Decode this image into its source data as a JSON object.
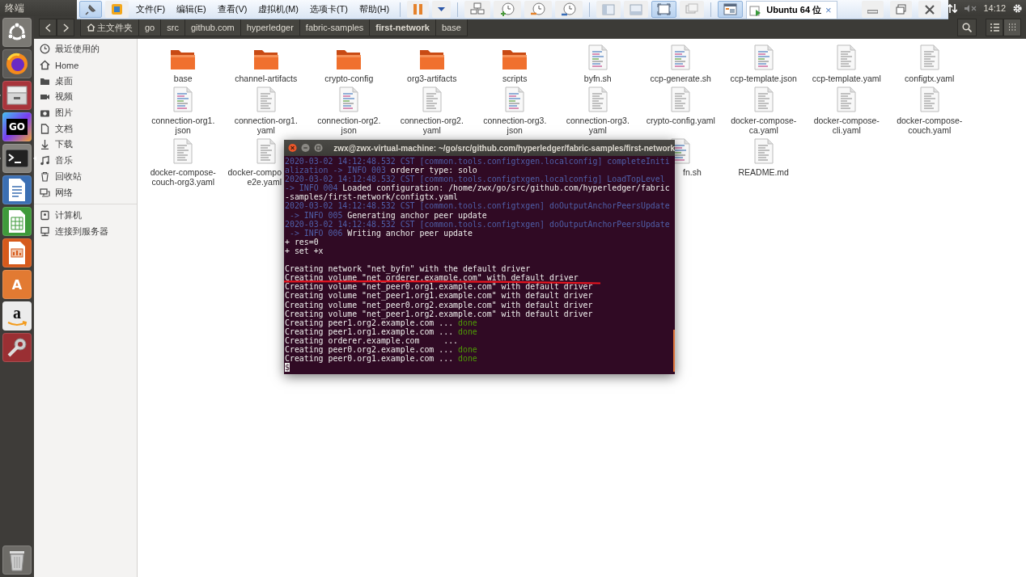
{
  "top_panel": {
    "app_title": "终端",
    "clock": "14:12",
    "tray": [
      {
        "kind": "network"
      },
      {
        "kind": "muted"
      },
      {
        "kind": "clock"
      },
      {
        "kind": "gear"
      }
    ]
  },
  "vm_toolbar": {
    "lead": [
      {
        "kind": "pin",
        "pressed": true
      },
      {
        "kind": "vm-logo",
        "pressed": false
      }
    ],
    "menus": [
      "文件(F)",
      "编辑(E)",
      "查看(V)",
      "虚拟机(M)",
      "选项卡(T)",
      "帮助(H)"
    ],
    "groups": [
      [
        {
          "kind": "pause",
          "pressed": false
        },
        {
          "kind": "caret",
          "pressed": false
        }
      ],
      [
        {
          "kind": "network",
          "pressed": false
        },
        {
          "kind": "snapshot-take",
          "pressed": false
        },
        {
          "kind": "snapshot-revert",
          "pressed": false
        },
        {
          "kind": "snapshot-manager",
          "pressed": false
        }
      ],
      [
        {
          "kind": "view-console",
          "pressed": false
        },
        {
          "kind": "view-thumb",
          "pressed": false
        },
        {
          "kind": "fullscreen",
          "pressed": true
        },
        {
          "kind": "unity",
          "pressed": false
        }
      ],
      [
        {
          "kind": "library",
          "pressed": true
        }
      ]
    ],
    "tab": {
      "label": "Ubuntu 64 位",
      "close": "×"
    },
    "window_buttons": [
      {
        "kind": "minimize"
      },
      {
        "kind": "restore"
      },
      {
        "kind": "close"
      }
    ]
  },
  "launcher": {
    "items": [
      {
        "kind": "dash",
        "running": false,
        "focused": false
      },
      {
        "kind": "firefox",
        "running": false,
        "focused": false
      },
      {
        "kind": "files",
        "running": true,
        "focused": false
      },
      {
        "kind": "goland",
        "glyph": "GO",
        "running": false,
        "focused": false
      },
      {
        "kind": "terminal",
        "running": true,
        "focused": true
      },
      {
        "kind": "writer",
        "running": false,
        "focused": false
      },
      {
        "kind": "calc",
        "running": false,
        "focused": false
      },
      {
        "kind": "impress",
        "running": false,
        "focused": false
      },
      {
        "kind": "software",
        "glyph": "A",
        "running": false,
        "focused": false
      },
      {
        "kind": "amazon",
        "glyph": "a",
        "running": false,
        "focused": false
      },
      {
        "kind": "settings",
        "running": false,
        "focused": false
      }
    ],
    "trash": {
      "kind": "trash"
    }
  },
  "header": {
    "breadcrumbs": [
      {
        "label": "主文件夹",
        "home": true,
        "selected": false
      },
      {
        "label": "go",
        "home": false,
        "selected": false
      },
      {
        "label": "src",
        "home": false,
        "selected": false
      },
      {
        "label": "github.com",
        "home": false,
        "selected": false
      },
      {
        "label": "hyperledger",
        "home": false,
        "selected": false
      },
      {
        "label": "fabric-samples",
        "home": false,
        "selected": false
      },
      {
        "label": "first-network",
        "home": false,
        "selected": true
      },
      {
        "label": "base",
        "home": false,
        "selected": false
      }
    ],
    "view_buttons": [
      {
        "kind": "list",
        "selected": false
      },
      {
        "kind": "grid",
        "selected": true
      }
    ]
  },
  "sidebar": {
    "sections": [
      {
        "items": [
          {
            "kind": "recent",
            "label": "最近使用的"
          },
          {
            "kind": "home",
            "label": "Home"
          },
          {
            "kind": "desktop",
            "label": "桌面"
          },
          {
            "kind": "video",
            "label": "视频"
          },
          {
            "kind": "picture",
            "label": "图片"
          },
          {
            "kind": "document",
            "label": "文档"
          },
          {
            "kind": "download",
            "label": "下载"
          },
          {
            "kind": "music",
            "label": "音乐"
          },
          {
            "kind": "trash",
            "label": "回收站"
          },
          {
            "kind": "network",
            "label": "网络"
          }
        ]
      },
      {
        "items": [
          {
            "kind": "computer",
            "label": "计算机"
          },
          {
            "kind": "server",
            "label": "连接到服务器"
          }
        ]
      }
    ]
  },
  "files": [
    {
      "kind": "folder",
      "lines": [
        "base"
      ]
    },
    {
      "kind": "folder",
      "lines": [
        "channel-artifacts"
      ]
    },
    {
      "kind": "folder",
      "lines": [
        "crypto-config"
      ]
    },
    {
      "kind": "folder",
      "lines": [
        "org3-artifacts"
      ]
    },
    {
      "kind": "folder",
      "lines": [
        "scripts"
      ]
    },
    {
      "kind": "script",
      "lines": [
        "byfn.sh"
      ]
    },
    {
      "kind": "script",
      "lines": [
        "ccp-generate.sh"
      ]
    },
    {
      "kind": "script",
      "lines": [
        "ccp-template.json"
      ]
    },
    {
      "kind": "text",
      "lines": [
        "ccp-template.yaml"
      ]
    },
    {
      "kind": "text",
      "lines": [
        "configtx.yaml"
      ]
    },
    {
      "kind": "script",
      "lines": [
        "connection-org1.",
        "json"
      ]
    },
    {
      "kind": "text",
      "lines": [
        "connection-org1.",
        "yaml"
      ]
    },
    {
      "kind": "script",
      "lines": [
        "connection-org2.",
        "json"
      ]
    },
    {
      "kind": "text",
      "lines": [
        "connection-org2.",
        "yaml"
      ]
    },
    {
      "kind": "script",
      "lines": [
        "connection-org3.",
        "json"
      ]
    },
    {
      "kind": "text",
      "lines": [
        "connection-org3.",
        "yaml"
      ]
    },
    {
      "kind": "text",
      "lines": [
        "crypto-config.yaml"
      ]
    },
    {
      "kind": "text",
      "lines": [
        "docker-compose-",
        "ca.yaml"
      ]
    },
    {
      "kind": "text",
      "lines": [
        "docker-compose-",
        "cli.yaml"
      ]
    },
    {
      "kind": "text",
      "lines": [
        "docker-compose-",
        "couch.yaml"
      ]
    },
    {
      "kind": "text",
      "lines": [
        "docker-compose-",
        "couch-org3.yaml"
      ]
    },
    {
      "kind": "text-cut-right",
      "lines": [
        "docker-compo",
        "e2e.yaml"
      ]
    },
    {
      "kind": "hidden"
    },
    {
      "kind": "hidden"
    },
    {
      "kind": "hidden"
    },
    {
      "kind": "hidden"
    },
    {
      "kind": "script-cut-left",
      "lines": [
        "fn.sh"
      ]
    },
    {
      "kind": "text",
      "lines": [
        "README.md"
      ]
    }
  ],
  "terminal": {
    "title": "zwx@zwx-virtual-machine: ~/go/src/github.com/hyperledger/fabric-samples/first-network",
    "title_buttons": [
      {
        "kind": "close"
      },
      {
        "kind": "minimize"
      },
      {
        "kind": "maximize"
      }
    ],
    "lines": [
      {
        "kind": "text",
        "segments": [
          {
            "kind": "log",
            "text": "2020-03-02 14:12:48.532 CST [common.tools.configtxgen.localconfig] completeIniti"
          }
        ]
      },
      {
        "kind": "text",
        "segments": [
          {
            "kind": "log",
            "text": "alization -> INFO 003"
          },
          {
            "kind": "plain",
            "text": " orderer type: solo"
          }
        ]
      },
      {
        "kind": "text",
        "segments": [
          {
            "kind": "log",
            "text": "2020-03-02 14:12:48.532 CST [common.tools.configtxgen.localconfig] LoadTopLevel"
          }
        ]
      },
      {
        "kind": "text",
        "segments": [
          {
            "kind": "log",
            "text": "-> INFO 004"
          },
          {
            "kind": "plain",
            "text": " Loaded configuration: /home/zwx/go/src/github.com/hyperledger/fabric"
          }
        ]
      },
      {
        "kind": "text",
        "segments": [
          {
            "kind": "plain",
            "text": "-samples/first-network/configtx.yaml"
          }
        ]
      },
      {
        "kind": "text",
        "segments": [
          {
            "kind": "log",
            "text": "2020-03-02 14:12:48.532 CST [common.tools.configtxgen] doOutputAnchorPeersUpdate"
          }
        ]
      },
      {
        "kind": "text",
        "segments": [
          {
            "kind": "log",
            "text": " -> INFO 005"
          },
          {
            "kind": "plain",
            "text": " Generating anchor peer update"
          }
        ]
      },
      {
        "kind": "text",
        "segments": [
          {
            "kind": "log",
            "text": "2020-03-02 14:12:48.532 CST [common.tools.configtxgen] doOutputAnchorPeersUpdate"
          }
        ]
      },
      {
        "kind": "text",
        "segments": [
          {
            "kind": "log",
            "text": " -> INFO 006"
          },
          {
            "kind": "plain",
            "text": " Writing anchor peer update"
          }
        ]
      },
      {
        "kind": "text",
        "segments": [
          {
            "kind": "plain",
            "text": "+ res=0"
          }
        ]
      },
      {
        "kind": "text",
        "segments": [
          {
            "kind": "plain",
            "text": "+ set +x"
          }
        ]
      },
      {
        "kind": "blank"
      },
      {
        "kind": "text",
        "segments": [
          {
            "kind": "plain",
            "text": "Creating network \"net_byfn\" with the default driver"
          }
        ]
      },
      {
        "kind": "text",
        "underlined": true,
        "segments": [
          {
            "kind": "plain",
            "text": "Creating volume \"net_orderer.example.com\" with default driver"
          }
        ]
      },
      {
        "kind": "text",
        "segments": [
          {
            "kind": "plain",
            "text": "Creating volume \"net_peer0.org1.example.com\" with default driver"
          }
        ]
      },
      {
        "kind": "text",
        "segments": [
          {
            "kind": "plain",
            "text": "Creating volume \"net_peer1.org1.example.com\" with default driver"
          }
        ]
      },
      {
        "kind": "text",
        "segments": [
          {
            "kind": "plain",
            "text": "Creating volume \"net_peer0.org2.example.com\" with default driver"
          }
        ]
      },
      {
        "kind": "text",
        "segments": [
          {
            "kind": "plain",
            "text": "Creating volume \"net_peer1.org2.example.com\" with default driver"
          }
        ]
      },
      {
        "kind": "text",
        "segments": [
          {
            "kind": "plain",
            "text": "Creating peer1.org2.example.com ... "
          },
          {
            "kind": "ok",
            "text": "done"
          }
        ]
      },
      {
        "kind": "text",
        "segments": [
          {
            "kind": "plain",
            "text": "Creating peer1.org1.example.com ... "
          },
          {
            "kind": "ok",
            "text": "done"
          }
        ]
      },
      {
        "kind": "text",
        "segments": [
          {
            "kind": "plain",
            "text": "Creating orderer.example.com     ..."
          }
        ]
      },
      {
        "kind": "text",
        "segments": [
          {
            "kind": "plain",
            "text": "Creating peer0.org2.example.com ... "
          },
          {
            "kind": "ok",
            "text": "done"
          }
        ]
      },
      {
        "kind": "text",
        "segments": [
          {
            "kind": "plain",
            "text": "Creating peer0.org1.example.com ... "
          },
          {
            "kind": "ok",
            "text": "done"
          }
        ]
      },
      {
        "kind": "text",
        "segments": [
          {
            "kind": "cursor",
            "text": "$"
          }
        ]
      }
    ],
    "annotation": {
      "kind": "underline",
      "color": "#e8141e"
    }
  }
}
